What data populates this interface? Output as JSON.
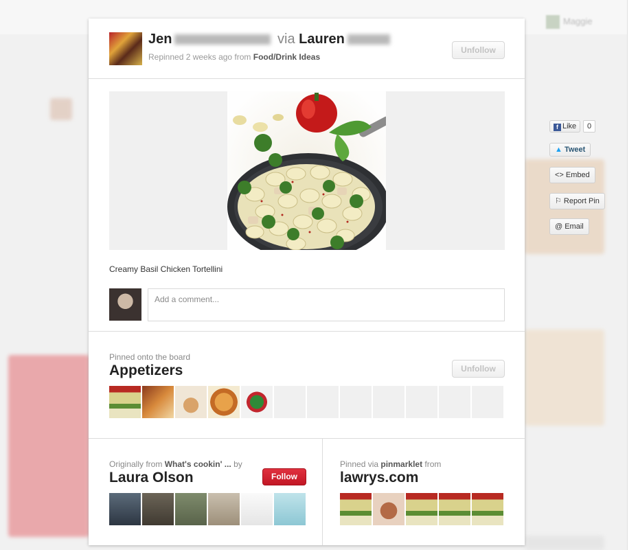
{
  "background": {
    "user_name": "Maggie"
  },
  "header": {
    "name_first": "Jen",
    "via_word": "via",
    "via_first": "Lauren",
    "repinned_text": "Repinned 2 weeks ago from",
    "repinned_board": "Food/Drink Ideas",
    "unfollow_label": "Unfollow"
  },
  "pin": {
    "caption": "Creamy Basil Chicken Tortellini",
    "comment_placeholder": "Add a comment..."
  },
  "board": {
    "label": "Pinned onto the board",
    "name": "Appetizers",
    "unfollow_label": "Unfollow",
    "thumb_count": 5,
    "empty_slots": 7
  },
  "origin": {
    "label_prefix": "Originally from",
    "source": "What's cookin' ...",
    "label_by": "by",
    "name": "Laura Olson",
    "follow_label": "Follow"
  },
  "pinned_via": {
    "label_prefix": "Pinned via",
    "tool": "pinmarklet",
    "label_from": "from",
    "domain": "lawrys.com"
  },
  "share": {
    "like_label": "Like",
    "like_count": "0",
    "tweet_label": "Tweet",
    "embed_label": "<> Embed",
    "report_label": "⚐ Report Pin",
    "email_label": "@ Email"
  },
  "colors": {
    "follow_red": "#cb2027",
    "facebook_blue": "#3b5998",
    "twitter_blue": "#1da1f2"
  }
}
